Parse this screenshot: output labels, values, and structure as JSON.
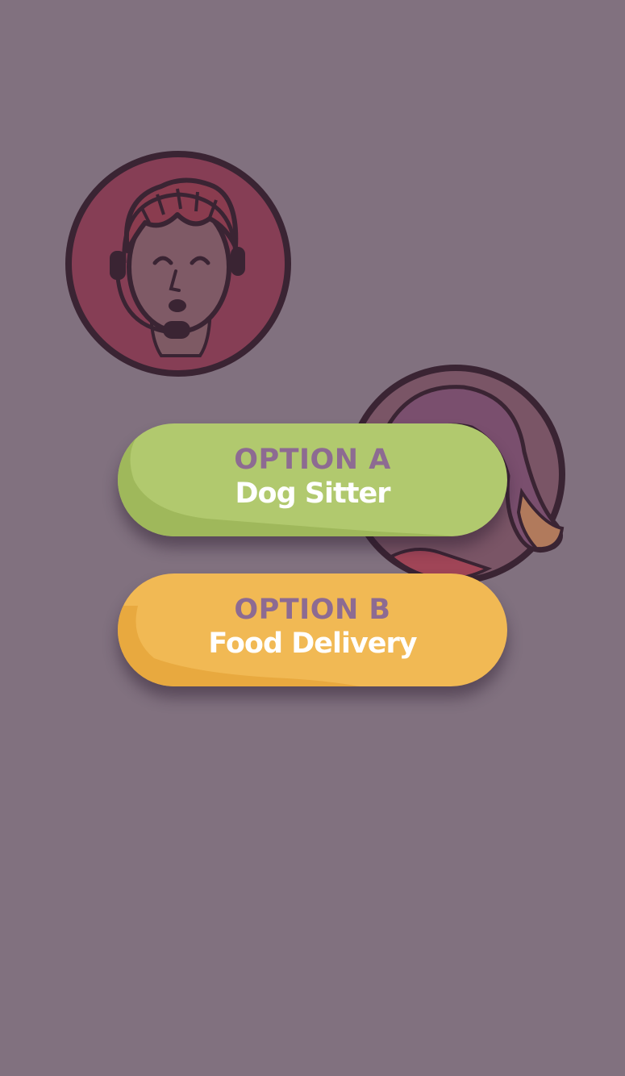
{
  "scene": {
    "background_color": "#81717f",
    "characters": [
      {
        "name": "operator-with-headset",
        "icon": "operator-avatar-icon"
      },
      {
        "name": "customer-with-long-hair",
        "icon": "customer-avatar-icon"
      }
    ]
  },
  "choices": {
    "option_a": {
      "label": "OPTION A",
      "value": "Dog Sitter",
      "color": "#b1c96e"
    },
    "option_b": {
      "label": "OPTION B",
      "value": "Food Delivery",
      "color": "#f1b954"
    }
  },
  "colors": {
    "label_text": "#8d6b92",
    "value_text": "#ffffff",
    "avatar_ring": "#3a2433",
    "avatar_fill": "#863e55"
  }
}
